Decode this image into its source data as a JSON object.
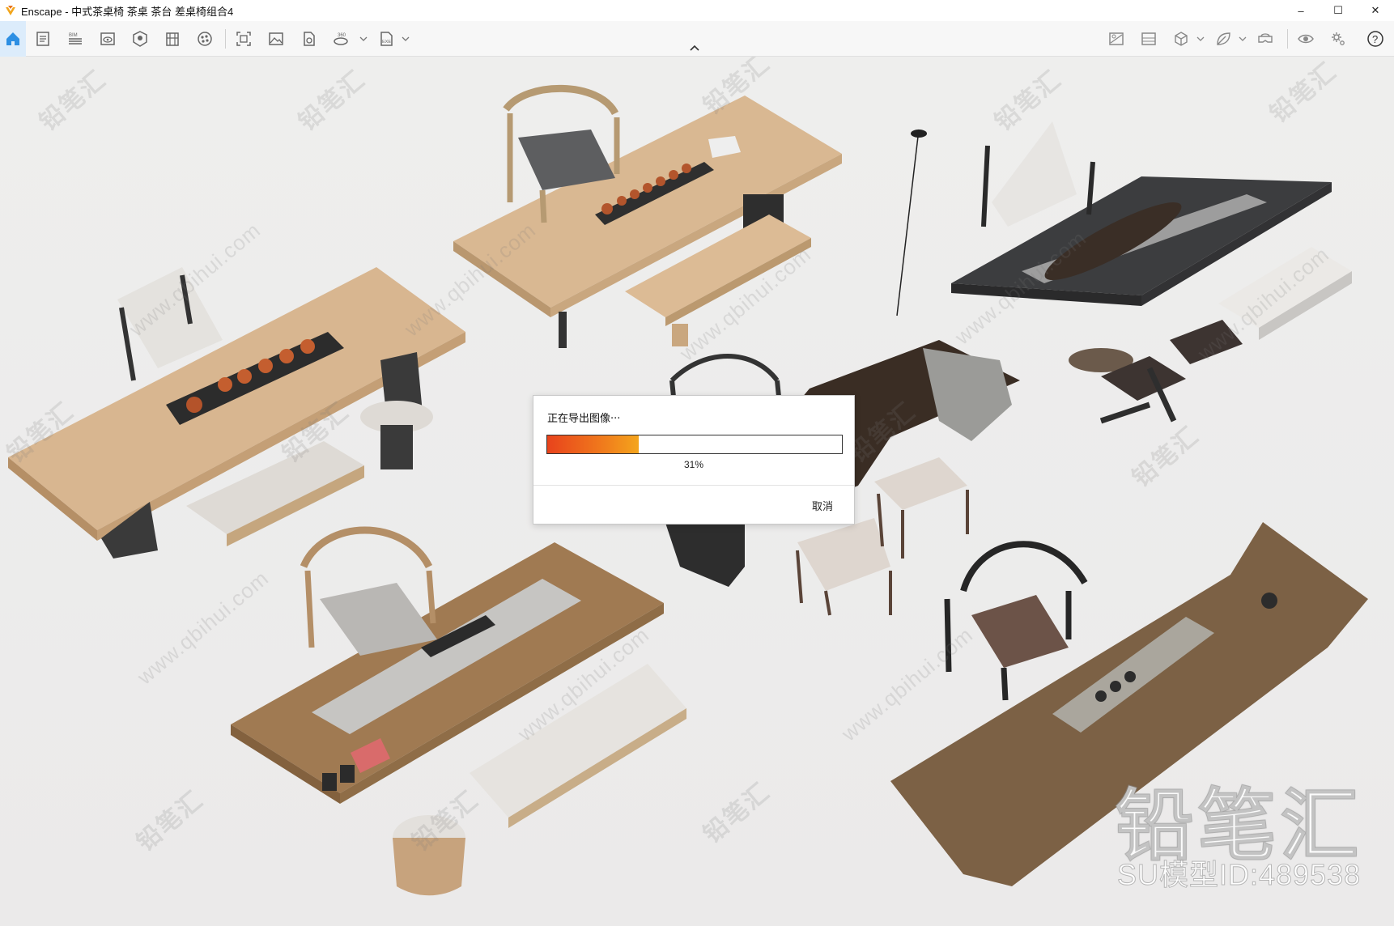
{
  "window": {
    "title": "Enscape - 中式茶桌椅 茶桌 茶台  差桌椅组合4",
    "controls": {
      "minimize": "–",
      "maximize": "☐",
      "close": "✕"
    }
  },
  "toolbar": {
    "icons": [
      "home-icon",
      "document-icon",
      "bim-icon",
      "view-icon",
      "asset-library-icon",
      "building-icon",
      "material-icon",
      "screenshot-icon",
      "image-icon",
      "export-icon",
      "panorama-360-icon",
      "exe-export-icon",
      "settings-icon",
      "visual-icon",
      "cube-icon",
      "leaf-icon",
      "vr-icon",
      "eye-icon",
      "gear-icon",
      "help-icon"
    ],
    "bim_label": "BIM",
    "pano_label": "360",
    "exe_label": "EXE",
    "help_label": "?"
  },
  "colors": {
    "accent": "#e8431c",
    "home_active": "#2d8fe3"
  },
  "watermark": {
    "brand": "铅笔汇",
    "url": "www.qbihui.com",
    "model_id": "SU模型ID:489538"
  },
  "dialog": {
    "title": "正在导出图像···",
    "progress_fraction": 0.31,
    "progress_label": "31%",
    "cancel_label": "取消"
  }
}
